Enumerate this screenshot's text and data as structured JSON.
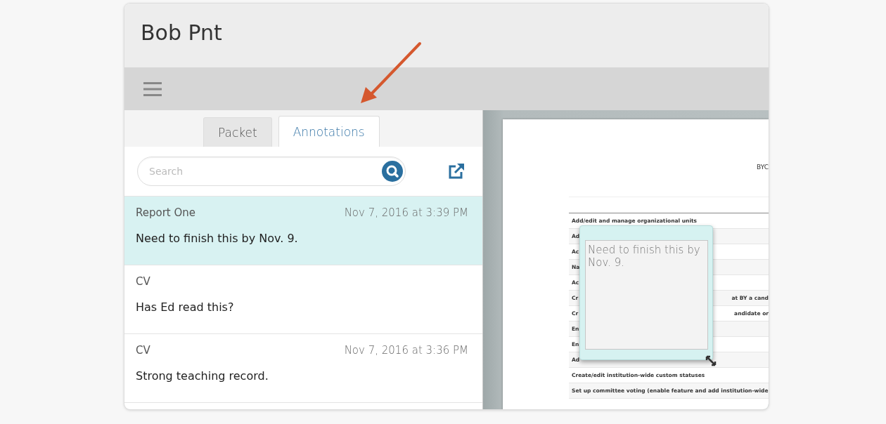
{
  "title": "Bob Pnt",
  "tabs": [
    {
      "label": "Packet",
      "selected": false
    },
    {
      "label": "Annotations",
      "selected": true
    }
  ],
  "search": {
    "placeholder": "Search"
  },
  "annotations": [
    {
      "source": "Report One",
      "date": "Nov 7, 2016 at 3:39 PM",
      "text": "Need to finish this by Nov. 9.",
      "selected": true
    },
    {
      "source": "CV",
      "text": "Has Ed read this?",
      "selected": false
    },
    {
      "source": "CV",
      "date": "Nov 7, 2016 at 3:36 PM",
      "text": "Strong teaching record.",
      "selected": false
    }
  ],
  "document": {
    "heading": "BYC",
    "rows": [
      {
        "left": "Add/edit and manage organizational units"
      },
      {
        "left": "Ad"
      },
      {
        "left": "Ac"
      },
      {
        "left": "Na"
      },
      {
        "left": "Ac"
      },
      {
        "left": "Cr",
        "right": "at BY a cand"
      },
      {
        "left": "Cr",
        "right": "andidate or"
      },
      {
        "left": "En"
      },
      {
        "left": "En"
      },
      {
        "left": "Ad"
      },
      {
        "left": "Create/edit institution-wide custom statuses"
      },
      {
        "left": "Set up committee voting (enable feature and add institution-wide"
      }
    ]
  },
  "note_popup": {
    "value": "Need to finish this by Nov. 9."
  }
}
